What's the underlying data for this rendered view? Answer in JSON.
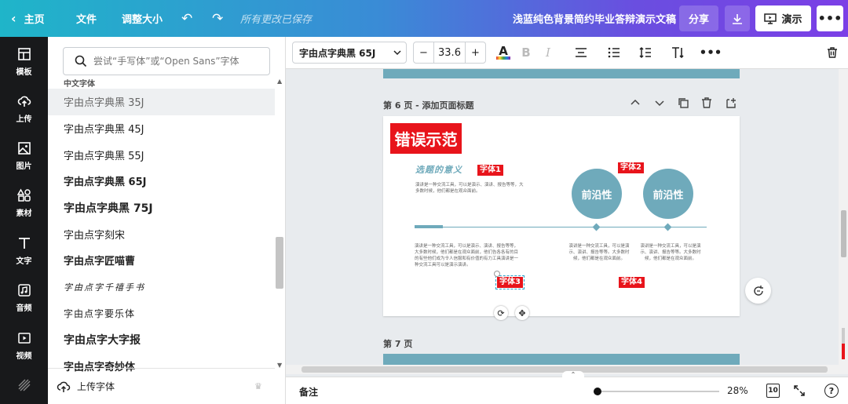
{
  "topbar": {
    "home": "主页",
    "file": "文件",
    "resize": "调整大小",
    "saved": "所有更改已保存",
    "doc_title": "浅蓝纯色背景简约毕业答辩演示文稿",
    "share": "分享",
    "present": "演示"
  },
  "rail": [
    {
      "label": "模板",
      "icon": "template-icon"
    },
    {
      "label": "上传",
      "icon": "upload-cloud-icon"
    },
    {
      "label": "图片",
      "icon": "image-icon"
    },
    {
      "label": "素材",
      "icon": "elements-icon"
    },
    {
      "label": "文字",
      "icon": "text-icon"
    },
    {
      "label": "音频",
      "icon": "audio-icon"
    },
    {
      "label": "视频",
      "icon": "video-icon"
    }
  ],
  "panel": {
    "search_placeholder": "尝试“手写体”或“Open Sans”字体",
    "section": "中文字体",
    "fonts": [
      "字由点字典黑 35J",
      "字由点字典黑 45J",
      "字由点字典黑 55J",
      "字由点字典黑 65J",
      "字由点字典黑 75J",
      "字由点字刻宋",
      "字由点字匠喵曹",
      "字由点字千禧手书",
      "字由点字要乐体",
      "字由点字大字报",
      "字由点字奇妙体"
    ],
    "upload": "上传字体"
  },
  "toolbar": {
    "font": "字由点字典黑 65J",
    "size": "33.6",
    "minus": "−",
    "plus": "+",
    "text_color_glyph": "A",
    "bold_glyph": "B",
    "italic_glyph": "I"
  },
  "canvas": {
    "page6_label": "第 6 页 - 添加页面标题",
    "page7_label": "第 7 页",
    "slide": {
      "title": "错误示范",
      "subtitle": "选题的意义",
      "tag1": "字体1",
      "tag2": "字体2",
      "tag3": "字体3",
      "tag4": "字体4",
      "circle1": "前沿性",
      "circle2": "前沿性",
      "text_top": "演讲是一种交流工具，可以是演示、演讲、报告等等，大多数时候，他们都是在观众面前。",
      "text_left": "演讲是一种交流工具，可以是演示、演讲、报告等等，大多数时候，他们都是在观众面前，他们告各各有的目的有些他们成为令人信服和有价值的有力工具演讲是一种交流工具可以是演示演讲。",
      "text_mid": "演讲是一种交流工具，可以是演示、演讲、报告等等。大多数时候，他们都是在观众面前。",
      "text_right": "演讲是一种交流工具，可以是演示、演讲、报告等等。大多数时候，他们都是在观众面前。"
    }
  },
  "bottombar": {
    "notes": "备注",
    "zoom": "28%",
    "page_count": "10",
    "help": "?"
  },
  "colors": {
    "accent_red": "#e8141b",
    "slide_teal": "#6faabb",
    "rail_bg": "#18191b"
  }
}
